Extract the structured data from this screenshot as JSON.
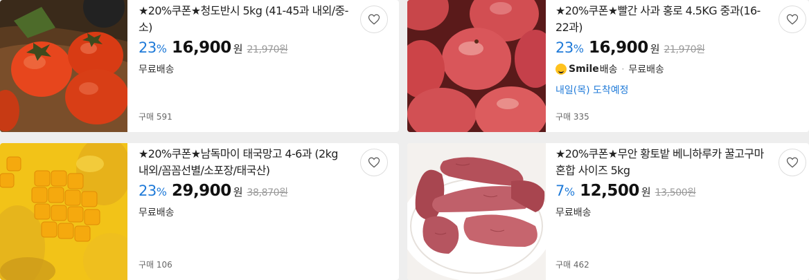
{
  "products": [
    {
      "title": "★20%쿠폰★청도반시 5kg (41-45과 내외/중-소)",
      "discount_rate": "23",
      "price": "16,900",
      "currency": "원",
      "original_price": "21,970원",
      "smile_brand": "",
      "smile_suffix": "",
      "shipping": "무료배송",
      "arrival": "",
      "purchase_count": "구매 591",
      "image_subject": "persimmons"
    },
    {
      "title": "★20%쿠폰★빨간 사과 홍로 4.5KG 중과(16-22과)",
      "discount_rate": "23",
      "price": "16,900",
      "currency": "원",
      "original_price": "21,970원",
      "smile_brand": "Smile",
      "smile_suffix": "배송",
      "shipping": "무료배송",
      "arrival": "내일(목) 도착예정",
      "purchase_count": "구매 335",
      "image_subject": "apples"
    },
    {
      "title": "★20%쿠폰★남독마이 태국망고 4-6과 (2kg 내외/꼼꼼선별/소포장/태국산)",
      "discount_rate": "23",
      "price": "29,900",
      "currency": "원",
      "original_price": "38,870원",
      "smile_brand": "",
      "smile_suffix": "",
      "shipping": "무료배송",
      "arrival": "",
      "purchase_count": "구매 106",
      "image_subject": "mangoes"
    },
    {
      "title": "★20%쿠폰★무안 황토밭 베니하루카 꿀고구마 혼합 사이즈 5kg",
      "discount_rate": "7",
      "price": "12,500",
      "currency": "원",
      "original_price": "13,500원",
      "smile_brand": "",
      "smile_suffix": "",
      "shipping": "무료배송",
      "arrival": "",
      "purchase_count": "구매 462",
      "image_subject": "sweet-potatoes"
    }
  ],
  "discount_suffix": "%",
  "colors": {
    "discount": "#1f7ad8",
    "arrival": "#1f7ad8",
    "smile_logo": "#ffc21e",
    "background": "#eeeeee"
  }
}
